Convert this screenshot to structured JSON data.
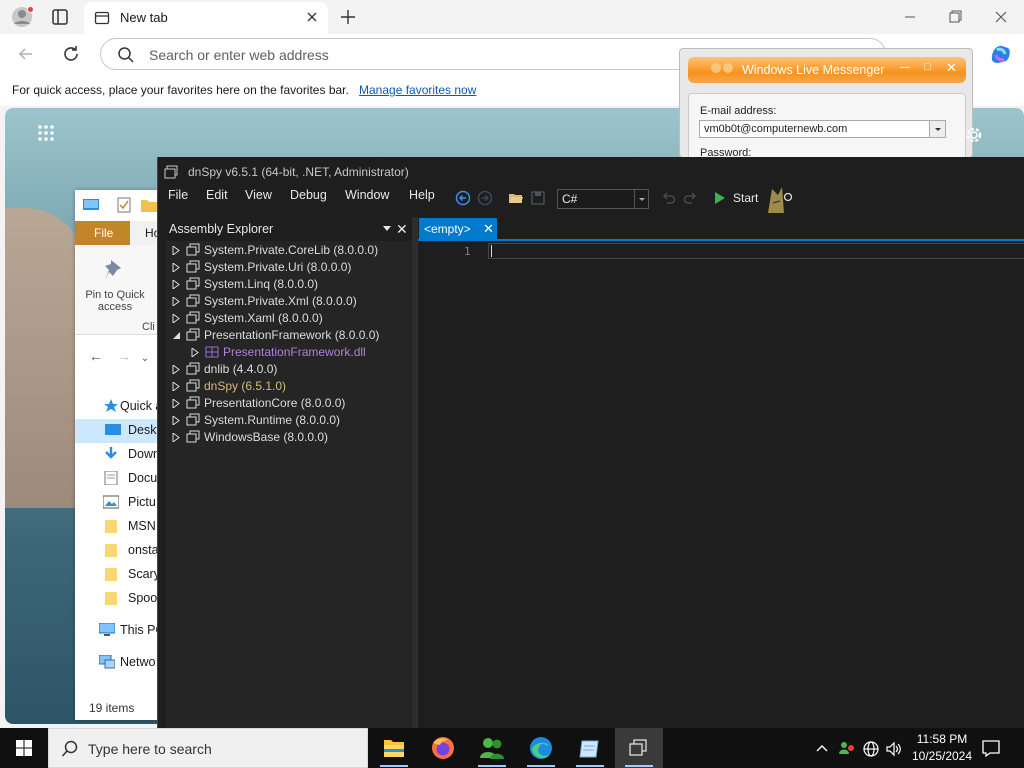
{
  "browser": {
    "tab_title": "New tab",
    "address_placeholder": "Search or enter web address",
    "favorites_message": "For quick access, place your favorites here on the favorites bar.",
    "favorites_link": "Manage favorites now"
  },
  "explorer": {
    "file_tab": "File",
    "home_tab": "Ho",
    "pin_label_1": "Pin to Quick",
    "pin_label_2": "access",
    "clip_label": "Cli",
    "nav_items": [
      "Quick a",
      "Deskt",
      "Down",
      "Docu",
      "Pictu",
      "MSN",
      "onsta",
      "Scary",
      "Spoo",
      "This PC",
      "Netwo"
    ],
    "status": "19 items"
  },
  "messenger": {
    "title": "Windows Live Messenger",
    "email_label": "E-mail address:",
    "email_value": "vm0b0t@computernewb.com",
    "password_label": "Password:"
  },
  "dnspy": {
    "title": "dnSpy v6.5.1 (64-bit, .NET, Administrator)",
    "menu": [
      "File",
      "Edit",
      "View",
      "Debug",
      "Window",
      "Help"
    ],
    "language": "C#",
    "start_label": "Start",
    "assembly_explorer_title": "Assembly Explorer",
    "assemblies": [
      "System.Private.CoreLib (8.0.0.0)",
      "System.Private.Uri (8.0.0.0)",
      "System.Linq (8.0.0.0)",
      "System.Private.Xml (8.0.0.0)",
      "System.Xaml (8.0.0.0)",
      "PresentationFramework (8.0.0.0)",
      "PresentationFramework.dll",
      "dnlib (4.4.0.0)",
      "dnSpy (6.5.1.0)",
      "PresentationCore (8.0.0.0)",
      "System.Runtime (8.0.0.0)",
      "WindowsBase (8.0.0.0)"
    ],
    "doc_tab": "<empty>",
    "line_number": "1"
  },
  "taskbar": {
    "search_placeholder": "Type here to search",
    "time": "11:58 PM",
    "date": "10/25/2024"
  }
}
